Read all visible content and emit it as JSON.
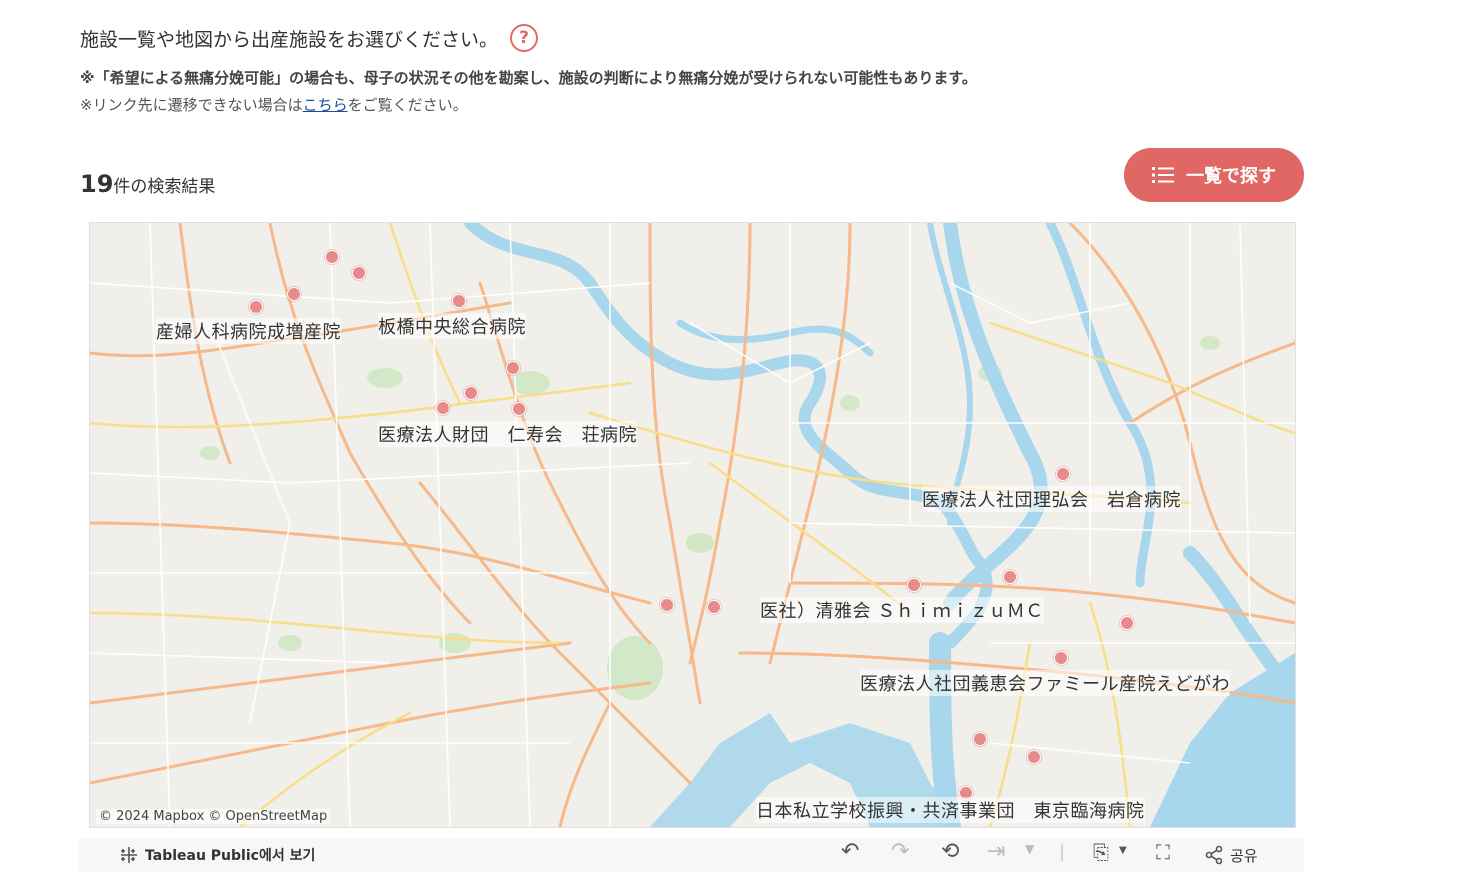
{
  "intro": {
    "text": "施設一覧や地図から出産施設をお選びください。",
    "help_icon": "question-circle-icon",
    "note1": "※「希望による無痛分娩可能」の場合も、母子の状況その他を勘案し、施設の判断により無痛分娩が受けられない可能性もあります。",
    "note2_prefix": "※リンク先に遷移できない場合は",
    "note2_link": "こちら",
    "note2_suffix": "をご覧ください。"
  },
  "results": {
    "count": "19",
    "suffix": "件の検索結果"
  },
  "list_button": {
    "label": "一覧で探す",
    "icon": "list-icon",
    "color": "#e06763"
  },
  "map": {
    "attribution": "© 2024 Mapbox  © OpenStreetMap",
    "labels": [
      "産婦人科病院成増産院",
      "板橋中央総合病院",
      "医療法人財団　仁寿会　荘病院",
      "医療法人社団理弘会　岩倉病院",
      "医社）清雅会 ＳｈｉｍｉｚｕＭＣ",
      "医療法人社団義恵会ファミール産院えどがわ",
      "日本私立学校振興・共済事業団　東京臨海病院"
    ],
    "marker_color": "#e8898a"
  },
  "toolbar": {
    "view_on_tableau": "Tableau Public에서 보기",
    "share_label": "공유",
    "icons": [
      "undo-icon",
      "redo-icon",
      "revert-icon",
      "refresh-icon",
      "download-icon",
      "fullscreen-icon",
      "share-icon"
    ]
  }
}
